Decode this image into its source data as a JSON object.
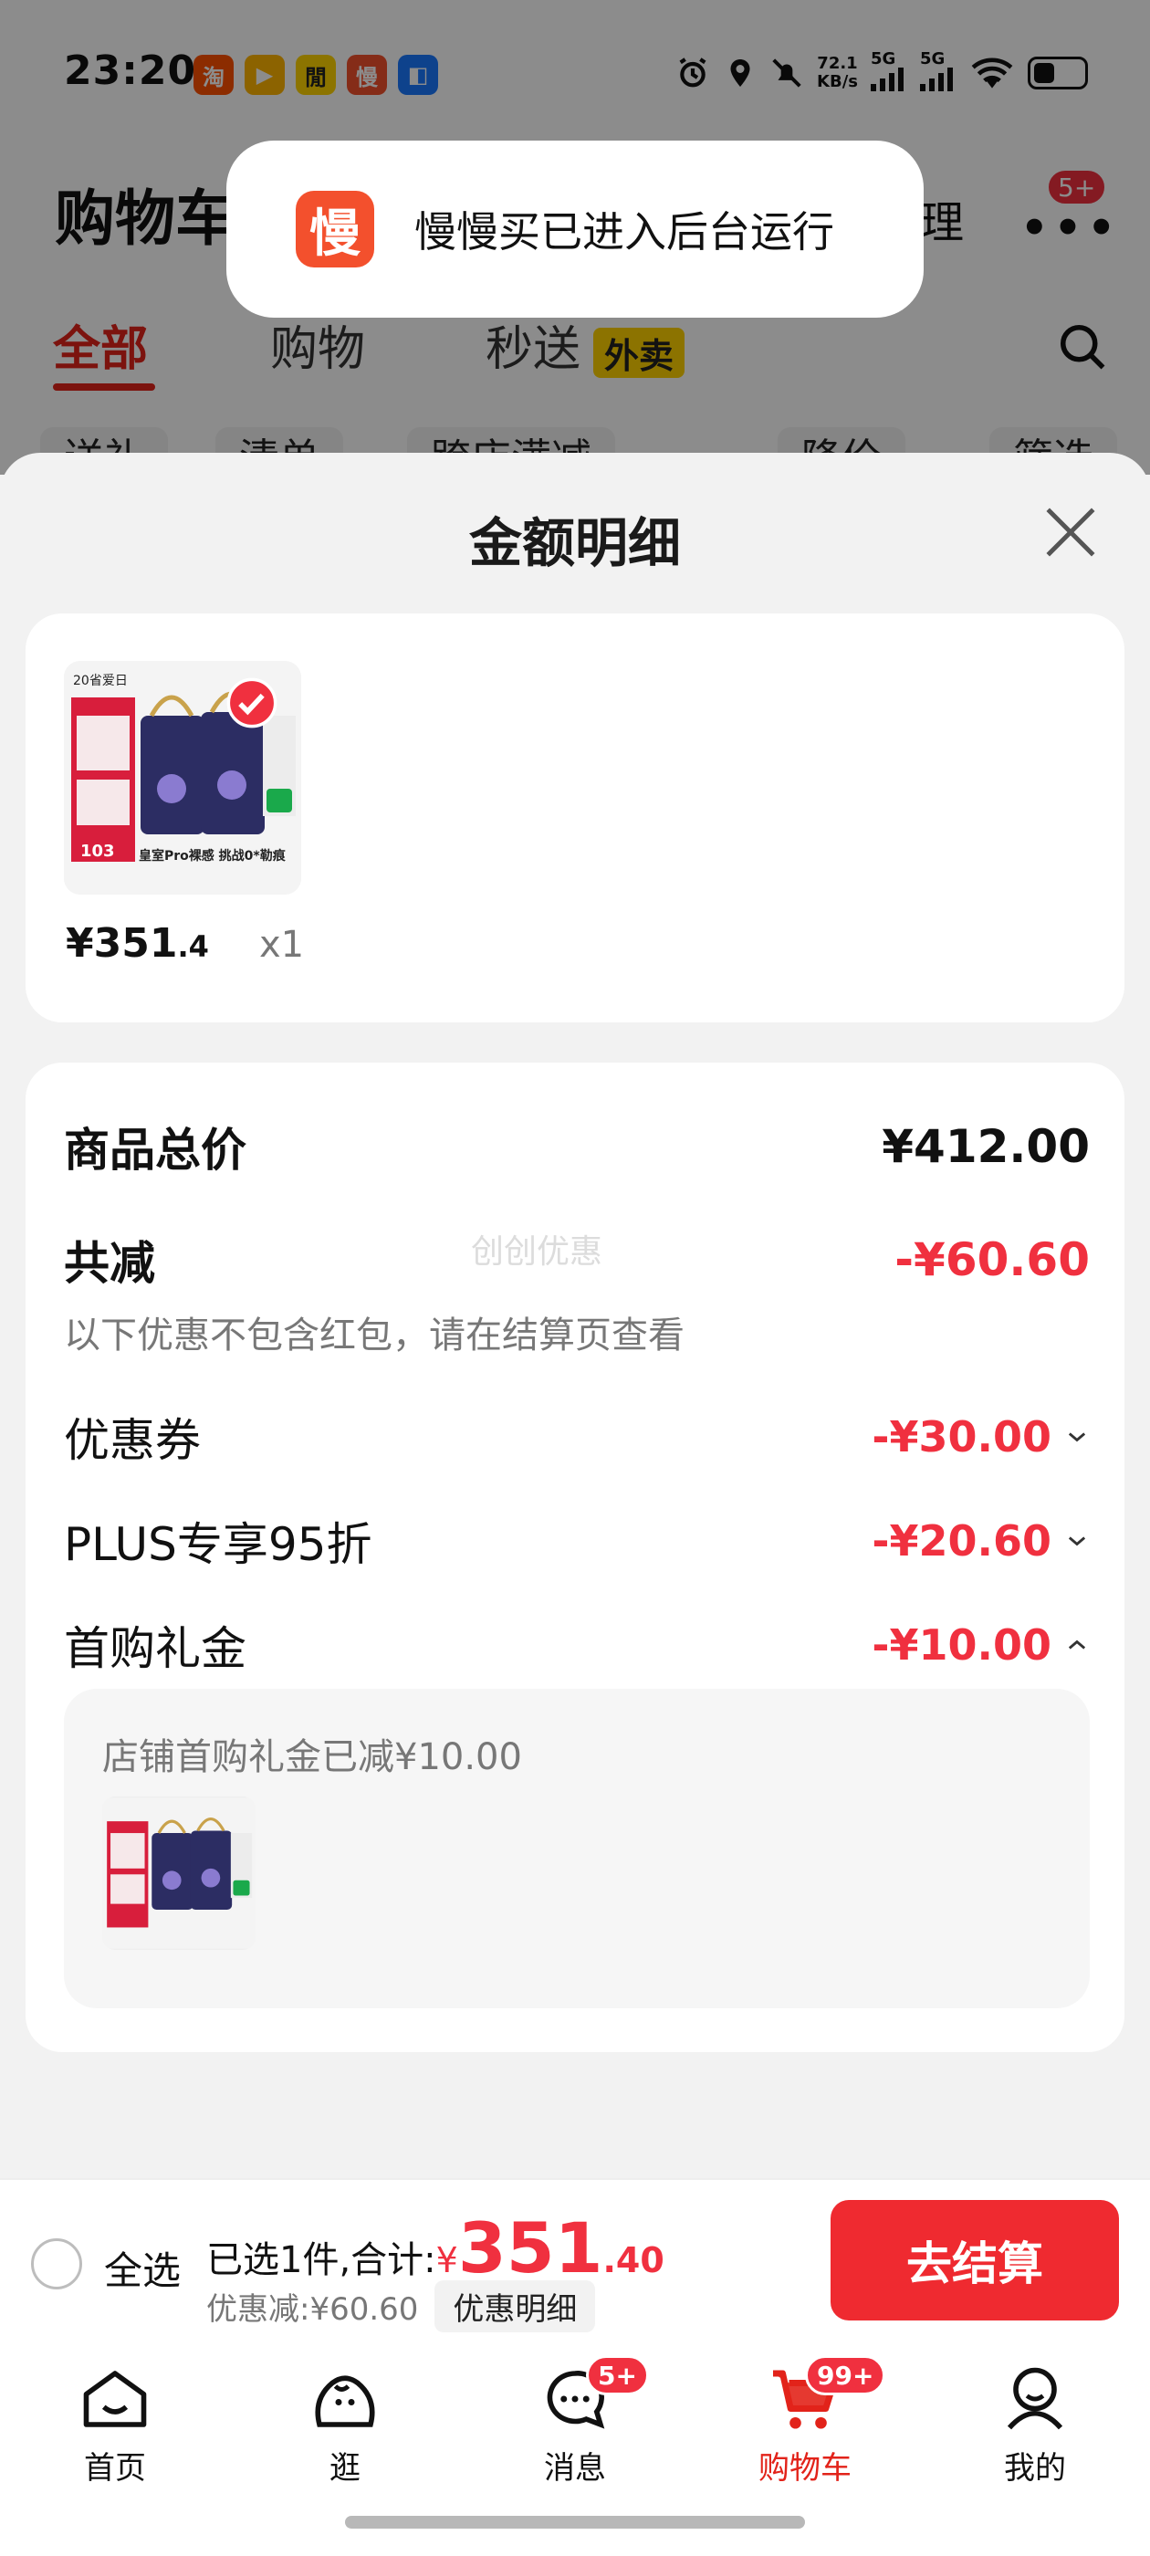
{
  "status_bar": {
    "time": "23:20",
    "apps": [
      {
        "glyph": "淘",
        "color": "#ff5000"
      },
      {
        "glyph": "▶",
        "color": "#ffb400"
      },
      {
        "glyph": "閒",
        "color": "#ffd400"
      },
      {
        "glyph": "慢",
        "color": "#f3502d"
      },
      {
        "glyph": "◧",
        "color": "#1a78ff"
      }
    ],
    "speed_top": "72.1",
    "speed_bottom": "KB/s",
    "net1": "5G",
    "net2": "5G"
  },
  "header": {
    "title": "购物车",
    "manage": "管理",
    "more_badge": "5+"
  },
  "toast": {
    "icon": "慢",
    "text": "慢慢买已进入后台运行"
  },
  "tabs": [
    {
      "label": "全部"
    },
    {
      "label": "购物"
    },
    {
      "label": "秒送"
    }
  ],
  "tab_tag": "外卖",
  "chips": [
    "送礼",
    "清单",
    "跨店满减",
    "降价",
    "筛选"
  ],
  "sheet": {
    "title": "金额明细",
    "product": {
      "price_int": "¥351",
      "price_dec": ".4",
      "qty": "x1",
      "image_caption": "皇室Pro裸感 挑战0*勒痕",
      "image_top": "20省爱日",
      "image_badge": "103"
    },
    "watermark": "创创优惠",
    "rows": {
      "total_label": "商品总价",
      "total_value": "¥412.00",
      "reduce_label": "共减",
      "reduce_value": "-¥60.60",
      "reduce_note": "以下优惠不包含红包，请在结算页查看",
      "coupon_label": "优惠券",
      "coupon_value": "-¥30.00",
      "plus_label": "PLUS专享95折",
      "plus_value": "-¥20.60",
      "gift_label": "首购礼金",
      "gift_value": "-¥10.00"
    },
    "gift_box": {
      "text": "店铺首购礼金已减¥10.00"
    }
  },
  "checkout": {
    "select_all": "全选",
    "selected_prefix": "已选1件,合计:",
    "currency": "¥",
    "total_int": "351",
    "total_dec": ".40",
    "discount": "优惠减:¥60.60",
    "detail_button": "优惠明细",
    "checkout_button": "去结算"
  },
  "tabbar": [
    {
      "label": "首页",
      "icon": "home-icon"
    },
    {
      "label": "逛",
      "icon": "browse-icon"
    },
    {
      "label": "消息",
      "icon": "message-icon",
      "badge": "5+"
    },
    {
      "label": "购物车",
      "icon": "cart-icon",
      "badge": "99+"
    },
    {
      "label": "我的",
      "icon": "profile-icon"
    }
  ],
  "colors": {
    "accent_red": "#f0303f",
    "brand_red": "#e2231a",
    "checkout_button": "#ef2a30"
  }
}
